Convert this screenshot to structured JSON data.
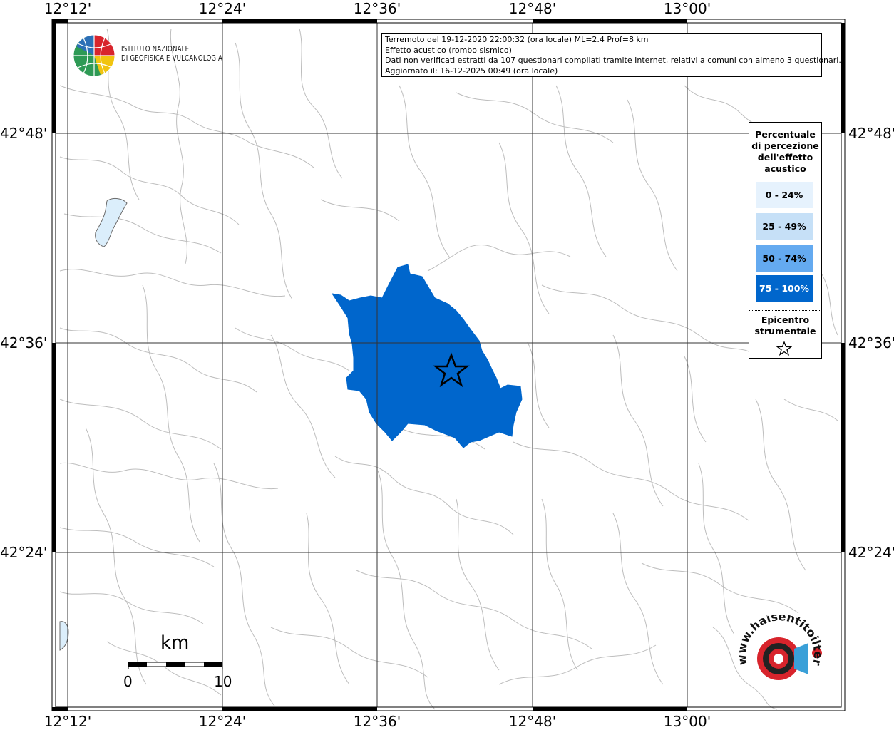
{
  "map": {
    "longitude_ticks": [
      "12°12'",
      "12°24'",
      "12°36'",
      "12°48'",
      "13°00'"
    ],
    "latitude_ticks": [
      "42°48'",
      "42°36'",
      "42°24'"
    ],
    "colors": {
      "felt_area": "#0066cc",
      "lake": "#dbeefb",
      "boundaries": "#bdbdbd",
      "grid": "#333333",
      "frame": "#000000"
    }
  },
  "info": {
    "line1": "Terremoto del 19-12-2020 22:00:32 (ora locale) ML=2.4 Prof=8 km",
    "line2": "Effetto acustico (rombo sismico)",
    "line3": "Dati non verificati estratti da 107 questionari compilati tramite Internet, relativi a comuni con almeno 3 questionari.",
    "line4": "Aggiornato il: 16-12-2025 00:49 (ora locale)"
  },
  "logo": {
    "line1": "ISTITUTO NAZIONALE",
    "line2": "DI GEOFISICA E VULCANOLOGIA"
  },
  "legend": {
    "title_lines": [
      "Percentuale",
      "di percezione",
      "dell'effetto",
      "acustico"
    ],
    "classes": [
      {
        "label": "0 - 24%",
        "color": "#e6f2fd",
        "text_color": "#000000"
      },
      {
        "label": "25 - 49%",
        "color": "#c6e0f7",
        "text_color": "#000000"
      },
      {
        "label": "50 - 74%",
        "color": "#64aaf0",
        "text_color": "#000000"
      },
      {
        "label": "75 - 100%",
        "color": "#0066cc",
        "text_color": "#ffffff"
      }
    ],
    "epicenter_lines": [
      "Epicentro",
      "strumentale"
    ],
    "epicenter_icon": "star-outline-icon"
  },
  "scalebar": {
    "unit": "km",
    "start": "0",
    "end": "10"
  },
  "watermark": {
    "text": "www.haisentitoilterremoto.it"
  }
}
